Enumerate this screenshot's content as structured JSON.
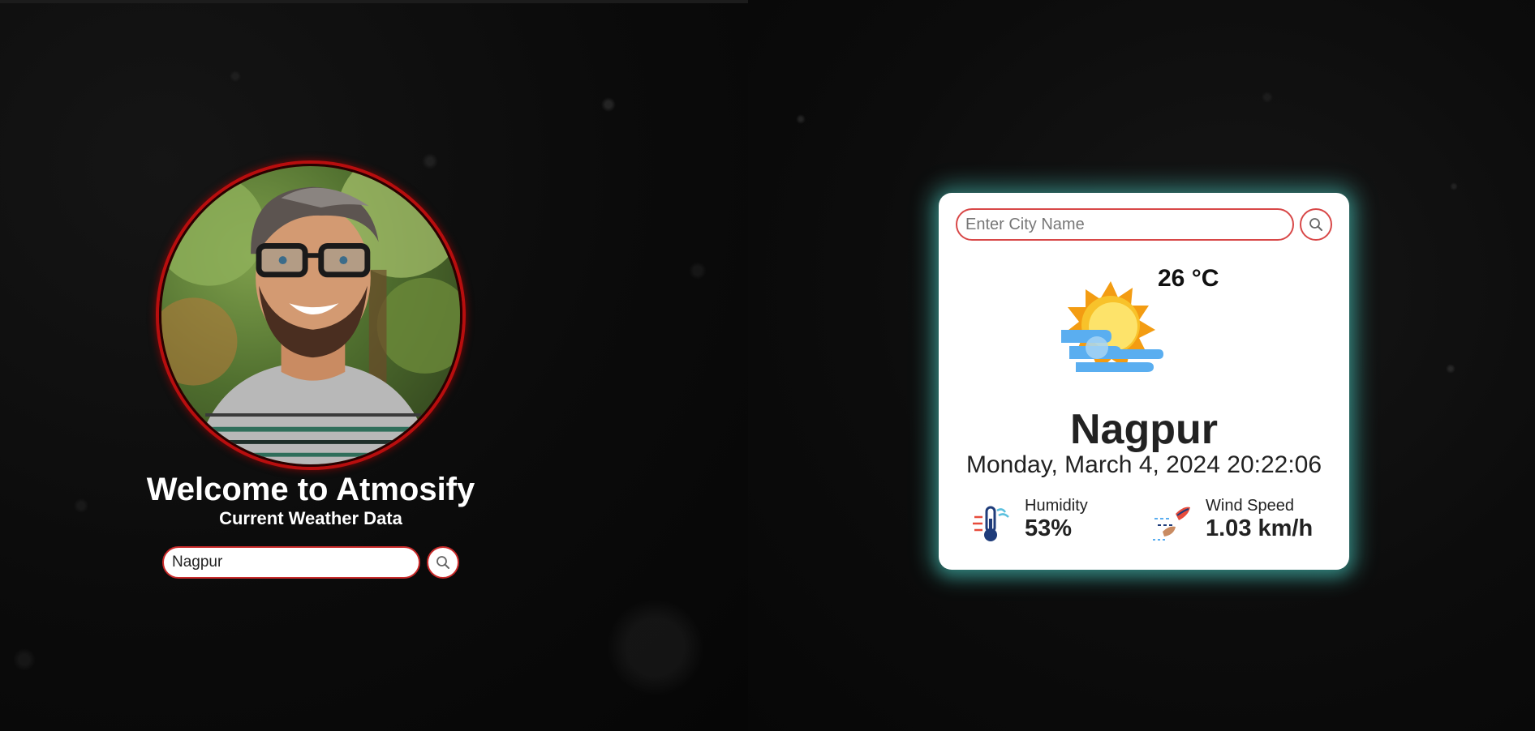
{
  "hero": {
    "title": "Welcome to Atmosify",
    "subtitle": "Current Weather Data",
    "search_value": "Nagpur",
    "search_icon": "search-icon",
    "accent_color": "#c92a2a"
  },
  "card": {
    "search_placeholder": "Enter City Name",
    "search_icon": "search-icon",
    "weather_icon": "sun-cloud-icon",
    "temperature": "26 °C",
    "city": "Nagpur",
    "datetime": "Monday, March 4, 2024 20:22:06",
    "humidity": {
      "label": "Humidity",
      "value": "53%",
      "icon": "thermometer-icon"
    },
    "wind": {
      "label": "Wind Speed",
      "value": "1.03 km/h",
      "icon": "wind-icon"
    },
    "glow_color": "#50d2c8"
  }
}
